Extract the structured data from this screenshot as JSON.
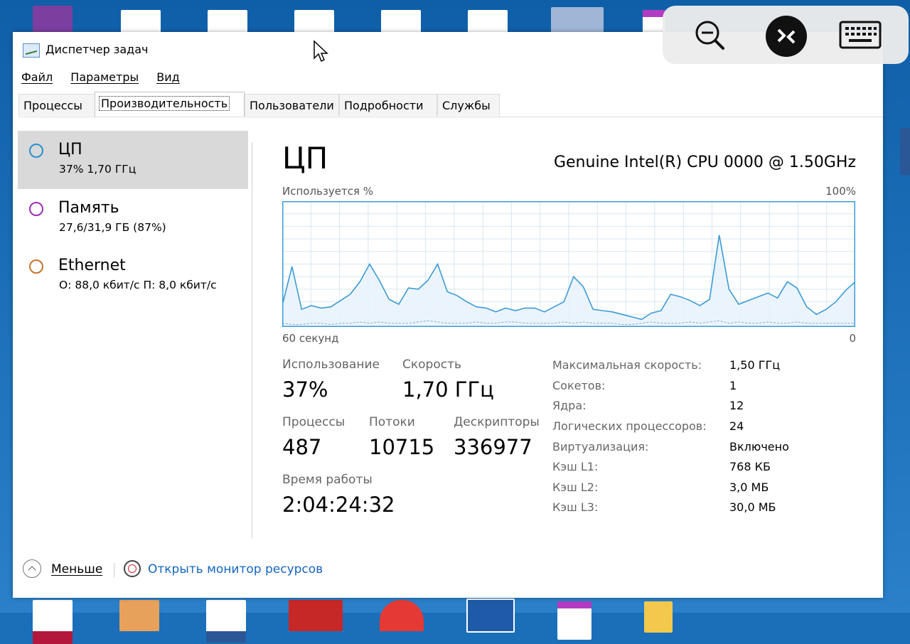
{
  "window": {
    "title": "Диспетчер задач",
    "menu": [
      "Файл",
      "Параметры",
      "Вид"
    ],
    "tabs": [
      "Процессы",
      "Производительность",
      "Пользователи",
      "Подробности",
      "Службы"
    ],
    "active_tab": "Производительность"
  },
  "resources": [
    {
      "name": "ЦП",
      "sub": "37% 1,70 ГГц",
      "color": "#2a8fd0",
      "selected": true
    },
    {
      "name": "Память",
      "sub": "27,6/31,9 ГБ (87%)",
      "color": "#9b2fb8",
      "selected": false
    },
    {
      "name": "Ethernet",
      "sub": "О: 88,0 кбит/с П: 8,0 кбит/с",
      "color": "#c8742a",
      "selected": false
    }
  ],
  "cpu": {
    "title": "ЦП",
    "name": "Genuine Intel(R) CPU 0000 @ 1.50GHz",
    "graph_label": "Используется %",
    "graph_max": "100%",
    "graph_time": "60 секунд",
    "graph_min": "0",
    "usage_label": "Использование",
    "usage_value": "37%",
    "speed_label": "Скорость",
    "speed_value": "1,70 ГГц",
    "processes_label": "Процессы",
    "processes_value": "487",
    "threads_label": "Потоки",
    "threads_value": "10715",
    "handles_label": "Дескрипторы",
    "handles_value": "336977",
    "uptime_label": "Время работы",
    "uptime_value": "2:04:24:32",
    "specs": [
      {
        "label": "Максимальная скорость:",
        "value": "1,50 ГГц"
      },
      {
        "label": "Сокетов:",
        "value": "1"
      },
      {
        "label": "Ядра:",
        "value": "12"
      },
      {
        "label": "Логических процессоров:",
        "value": "24"
      },
      {
        "label": "Виртуализация:",
        "value": "Включено"
      },
      {
        "label": "Кэш L1:",
        "value": "768 КБ"
      },
      {
        "label": "Кэш L2:",
        "value": "3,0 МБ"
      },
      {
        "label": "Кэш L3:",
        "value": "30,0 МБ"
      }
    ]
  },
  "chart_data": {
    "type": "area",
    "ylim": [
      0,
      100
    ],
    "series": [
      {
        "values": [
          17,
          48,
          14,
          17,
          15,
          16,
          21,
          26,
          36,
          50,
          37,
          22,
          18,
          31,
          30,
          37,
          50,
          28,
          25,
          20,
          16,
          15,
          12,
          15,
          13,
          15,
          15,
          12,
          16,
          20,
          40,
          32,
          14,
          13,
          12,
          10,
          8,
          6,
          11,
          13,
          26,
          24,
          21,
          17,
          22,
          73,
          30,
          18,
          21,
          24,
          27,
          23,
          36,
          31,
          16,
          10,
          14,
          20,
          29,
          36
        ]
      },
      {
        "values": [
          3,
          2,
          2,
          3,
          3,
          2,
          3,
          3,
          4,
          3,
          4,
          3,
          3,
          3,
          4,
          5,
          4,
          3,
          3,
          3,
          4,
          3,
          3,
          4,
          4,
          3,
          3,
          3,
          3,
          4,
          3,
          4,
          3,
          3,
          3,
          2,
          2,
          3,
          4,
          3,
          3,
          3,
          4,
          3,
          4,
          5,
          3,
          4,
          3,
          3,
          4,
          3,
          3,
          4,
          3,
          3,
          3,
          3,
          3,
          3
        ]
      }
    ]
  },
  "footer": {
    "less_label": "Меньше",
    "monitor_link": "Открыть монитор ресурсов"
  },
  "colors": {
    "cpu_line": "#3c9bd6",
    "cpu_fill": "#e8f2fb",
    "grid": "#d7e7f4",
    "graph_border": "#3c9bd6",
    "kernel_line": "#86aac6"
  }
}
